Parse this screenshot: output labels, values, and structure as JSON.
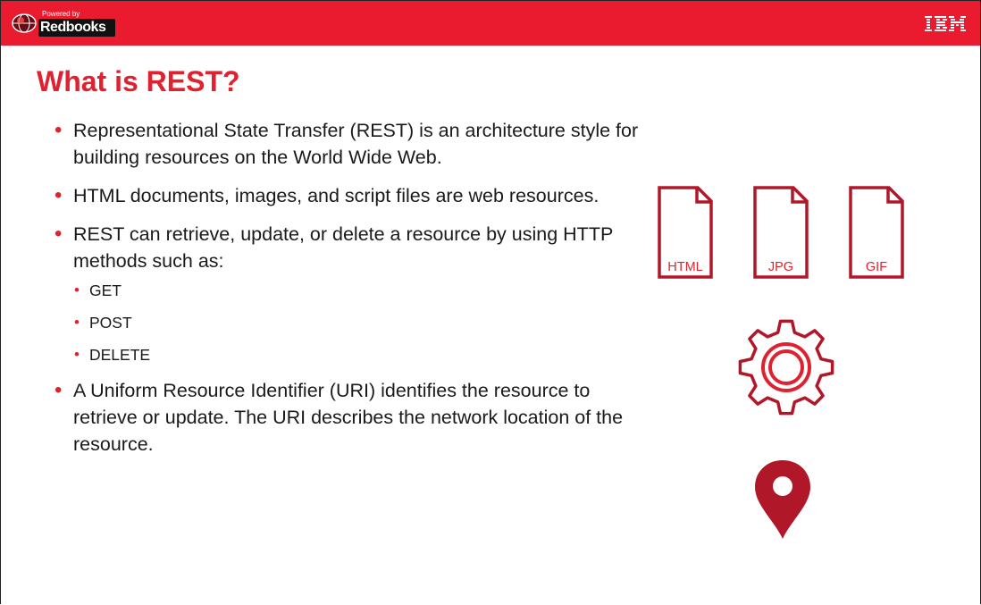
{
  "header": {
    "logo_powered_by": "Powered by",
    "logo_brand": "Redbooks",
    "ibm_logo": "IBM"
  },
  "slide": {
    "title": "What is REST?",
    "bullets": [
      {
        "text": "Representational State Transfer (REST) is an architecture style for building resources on the World Wide Web."
      },
      {
        "text": "HTML documents, images, and script files are web resources."
      },
      {
        "text": "REST can retrieve, update, or delete a resource by using HTTP methods such as:",
        "sub": [
          "GET",
          "POST",
          "DELETE"
        ]
      },
      {
        "text": "A Uniform Resource Identifier (URI) identifies the resource to retrieve or update. The URI describes the network location of the resource."
      }
    ]
  },
  "illustration": {
    "files": [
      "HTML",
      "JPG",
      "GIF"
    ],
    "icons": [
      "html-file-icon",
      "jpg-file-icon",
      "gif-file-icon",
      "gear-icon",
      "location-pin-icon"
    ]
  },
  "colors": {
    "header_red": "#ea1b2f",
    "title_red": "#e0212f",
    "icon_dark_red": "#b0182a",
    "text": "#1a1a1a"
  }
}
